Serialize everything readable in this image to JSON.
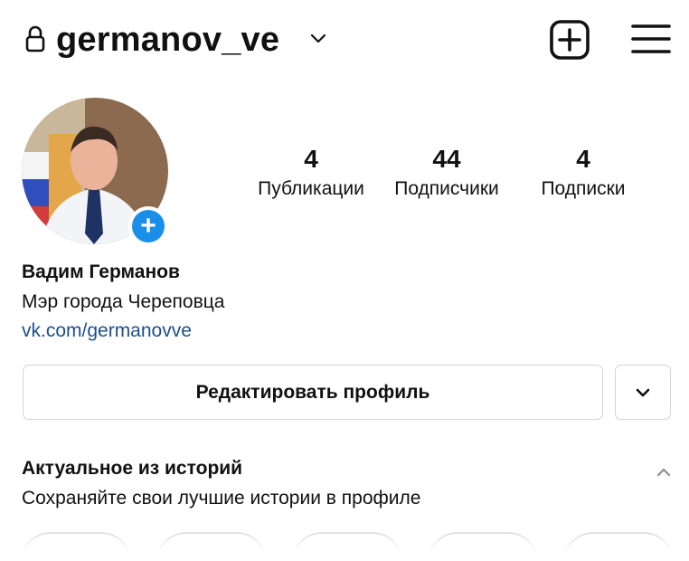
{
  "header": {
    "username": "germanov_ve"
  },
  "profile": {
    "stats": [
      {
        "count": "4",
        "label": "Публикации"
      },
      {
        "count": "44",
        "label": "Подписчики"
      },
      {
        "count": "4",
        "label": "Подписки"
      }
    ],
    "full_name": "Вадим Германов",
    "bio": "Мэр города Череповца",
    "link": "vk.com/germanovve"
  },
  "actions": {
    "edit_profile_label": "Редактировать профиль"
  },
  "highlights": {
    "title": "Актуальное из историй",
    "subtitle": "Сохраняйте свои лучшие истории в профиле"
  },
  "colors": {
    "accent_blue": "#1a8fe9",
    "link_color": "#1d4f8a",
    "border": "#d4d4d4"
  },
  "icons": [
    "lock-icon",
    "chevron-down-icon",
    "new-post-icon",
    "menu-icon",
    "add-story-icon",
    "chevron-up-icon"
  ]
}
